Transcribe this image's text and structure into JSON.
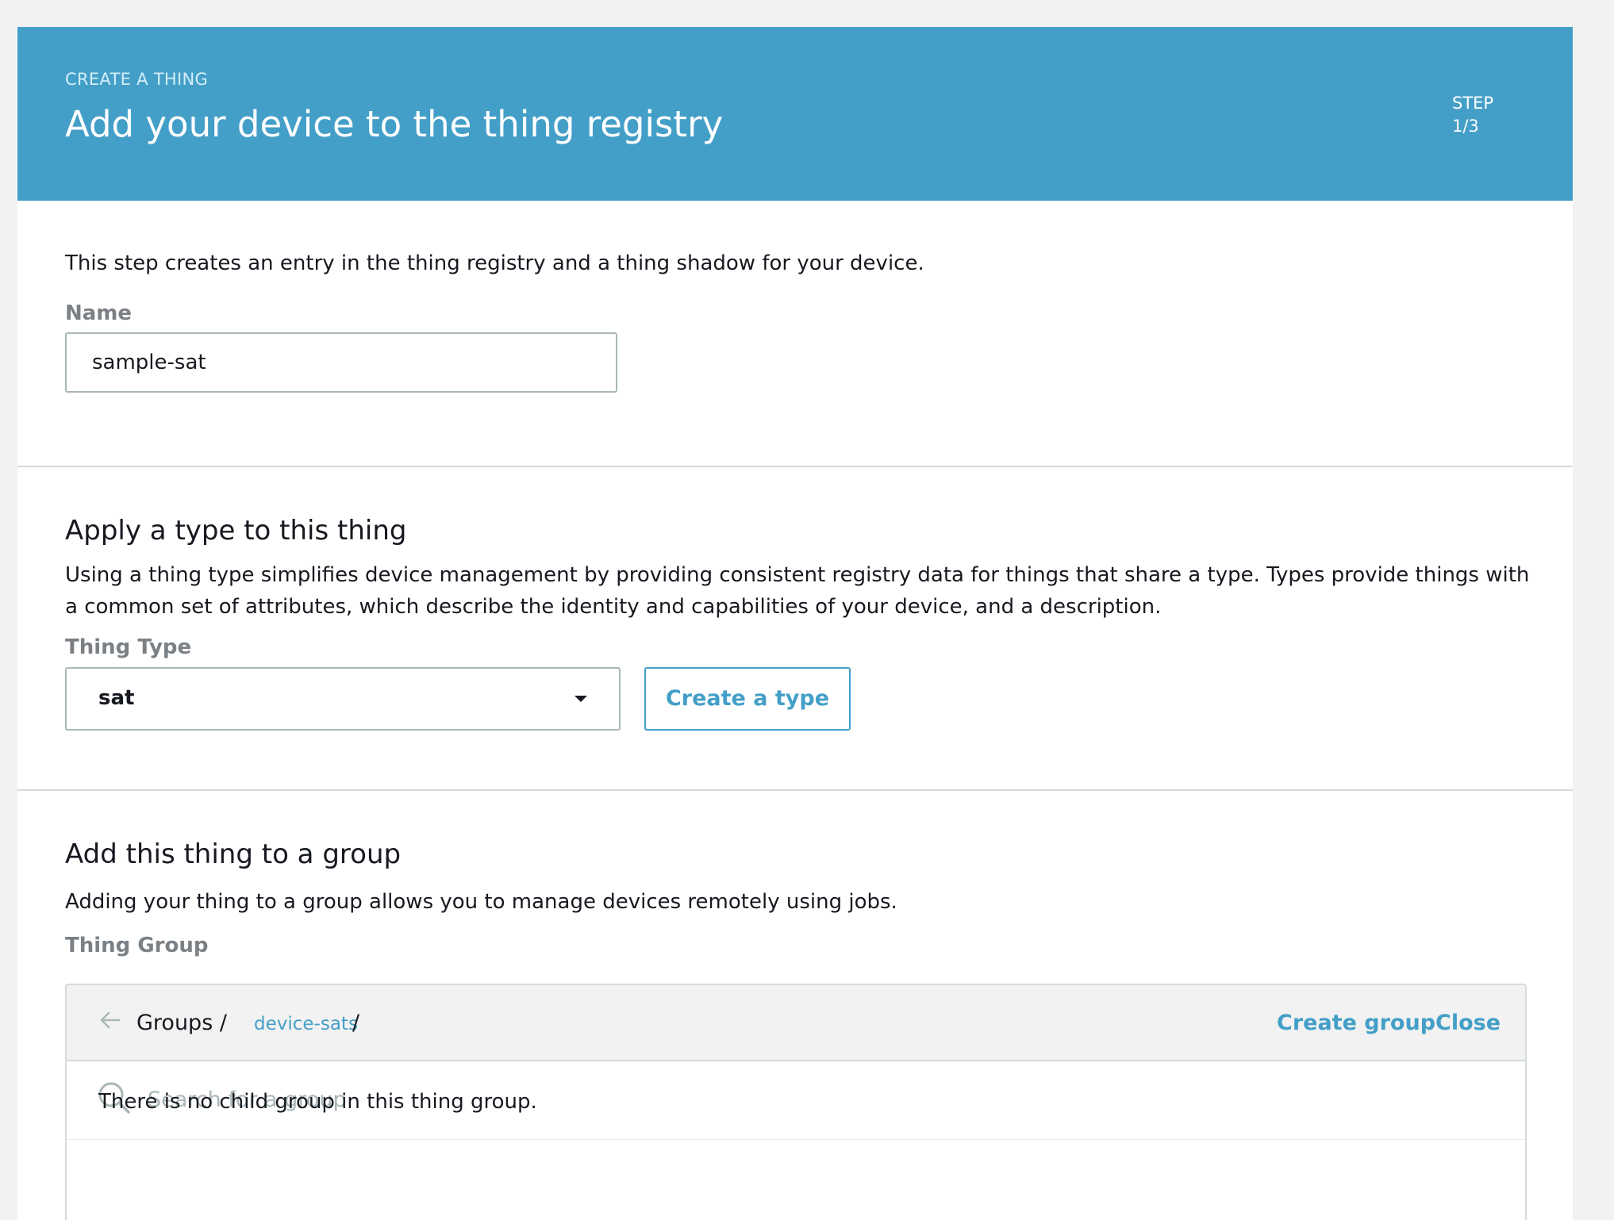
{
  "header": {
    "eyebrow": "CREATE A THING",
    "title": "Add your device to the thing registry",
    "step_label": "STEP",
    "step_value": "1/3"
  },
  "name_section": {
    "intro": "This step creates an entry in the thing registry and a thing shadow for your device.",
    "name_label": "Name",
    "name_value": "sample-sat"
  },
  "type_section": {
    "title": "Apply a type to this thing",
    "description": "Using a thing type simplifies device management by providing consistent registry data for things that share a type. Types provide things with a common set of attributes, which describe the identity and capabilities of your device, and a description.",
    "type_label": "Thing Type",
    "type_value": "sat",
    "create_type_button": "Create a type"
  },
  "group_section": {
    "title": "Add this thing to a group",
    "description": "Adding your thing to a group allows you to manage devices remotely using jobs.",
    "group_label": "Thing Group",
    "breadcrumb_root": "Groups /",
    "breadcrumb_current": "device-sats",
    "breadcrumb_sep": "/",
    "create_group_button": "Create group",
    "close_button": "Close",
    "search_placeholder": "Search for a group",
    "empty_message": "There is no child group in this thing group."
  },
  "colors": {
    "header_bg": "#449fc8",
    "accent": "#449fc8",
    "page_bg": "#f2f2f2"
  }
}
